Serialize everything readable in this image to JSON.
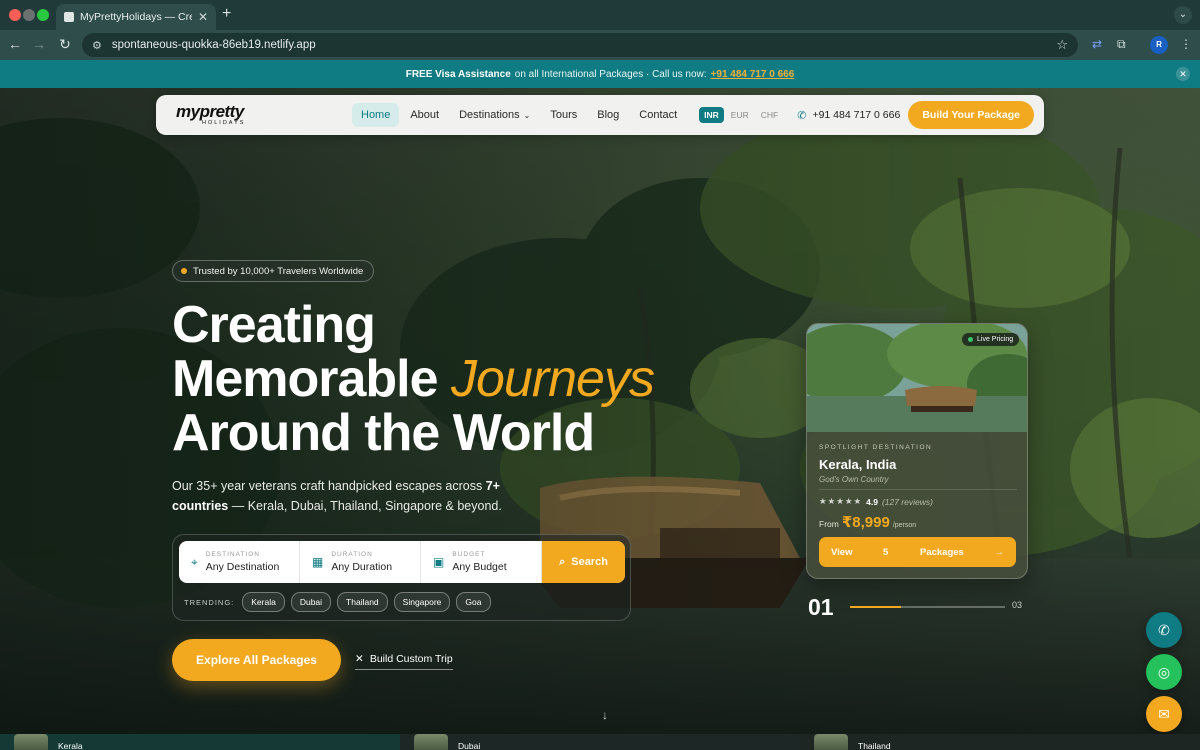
{
  "browser": {
    "tab_title": "MyPrettyHolidays — Creating",
    "url": "spontaneous-quokka-86eb19.netlify.app",
    "profile_initials": "R"
  },
  "announcement": {
    "bold": "FREE Visa Assistance",
    "text": "on all International Packages · Call us now:",
    "phone": "+91 484 717 0 666"
  },
  "nav": {
    "logo_main": "mypretty",
    "logo_sub": "HOLIDAYS",
    "items": [
      "Home",
      "About",
      "Destinations",
      "Tours",
      "Blog",
      "Contact"
    ],
    "currencies": [
      "INR",
      "EUR",
      "CHF"
    ],
    "phone": "+91 484 717 0 666",
    "cta": "Build Your Package"
  },
  "hero": {
    "badge": "Trusted by 10,000+ Travelers Worldwide",
    "headline_line1": "Creating",
    "headline_line2a": "Memorable",
    "headline_accent": "Journeys",
    "headline_line3": "Around the World",
    "sub_pre": "Our 35+ year veterans craft handpicked escapes across",
    "sub_bold": "7+ countries",
    "sub_post": "— Kerala, Dubai, Thailand, Singapore & beyond.",
    "explore_label": "Explore All Packages",
    "custom_label": "Build Custom Trip"
  },
  "search": {
    "fields": [
      {
        "label": "DESTINATION",
        "value": "Any Destination"
      },
      {
        "label": "DURATION",
        "value": "Any Duration"
      },
      {
        "label": "BUDGET",
        "value": "Any Budget"
      }
    ],
    "button": "Search",
    "trending_label": "TRENDING:",
    "trending": [
      "Kerala",
      "Dubai",
      "Thailand",
      "Singapore",
      "Goa"
    ]
  },
  "spotlight": {
    "live": "Live Pricing",
    "label": "SPOTLIGHT DESTINATION",
    "title": "Kerala, India",
    "tagline": "God's Own Country",
    "stars": "★★★★★",
    "rating": "4.9",
    "reviews": "(127 reviews)",
    "from": "From",
    "price": "₹8,999",
    "per": "/person",
    "btn_view": "View",
    "btn_count": "5",
    "btn_packages": "Packages",
    "btn_arrow": "→"
  },
  "slider": {
    "current": "01",
    "total": "03",
    "progress": 0.33
  },
  "bottom_strip": [
    "Kerala",
    "Dubai",
    "Thailand"
  ],
  "colors": {
    "accent": "#f2a91f",
    "teal": "#0f7b82",
    "whatsapp": "#25c15d"
  }
}
